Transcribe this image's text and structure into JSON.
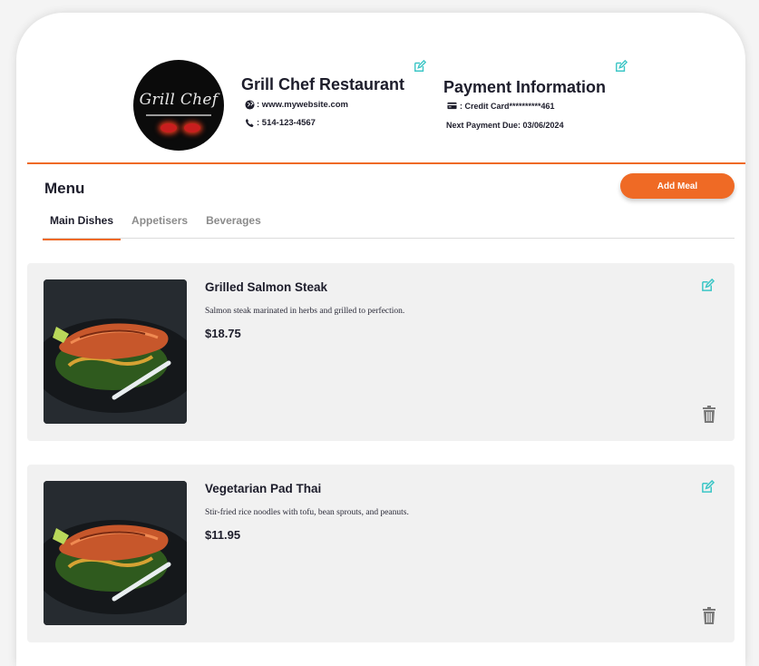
{
  "restaurant": {
    "logo_text": "Grill Chef",
    "name": "Grill Chef Restaurant",
    "website": ": www.mywebsite.com",
    "phone": ": 514-123-4567"
  },
  "payment": {
    "title": "Payment Information",
    "card": ": Credit Card**********461",
    "next_due": "Next Payment Due: 03/06/2024"
  },
  "menu": {
    "title": "Menu",
    "add_label": "Add Meal",
    "tabs": [
      {
        "label": "Main Dishes",
        "active": true
      },
      {
        "label": "Appetisers",
        "active": false
      },
      {
        "label": "Beverages",
        "active": false
      }
    ],
    "items": [
      {
        "name": "Grilled Salmon Steak",
        "description": "Salmon steak marinated in herbs and grilled to perfection.",
        "price": "$18.75"
      },
      {
        "name": "Vegetarian Pad Thai",
        "description": "Stir-fried rice noodles with tofu, bean sprouts, and peanuts.",
        "price": "$11.95"
      }
    ]
  },
  "icons": {
    "edit": "edit-icon",
    "trash": "trash-icon",
    "globe": "globe-icon",
    "phone": "phone-icon",
    "card": "credit-card-icon"
  },
  "colors": {
    "accent": "#ef6a25",
    "edit_icon": "#3cc6c6",
    "trash_icon": "#7a7a7a",
    "item_bg": "#f1f1f1"
  }
}
